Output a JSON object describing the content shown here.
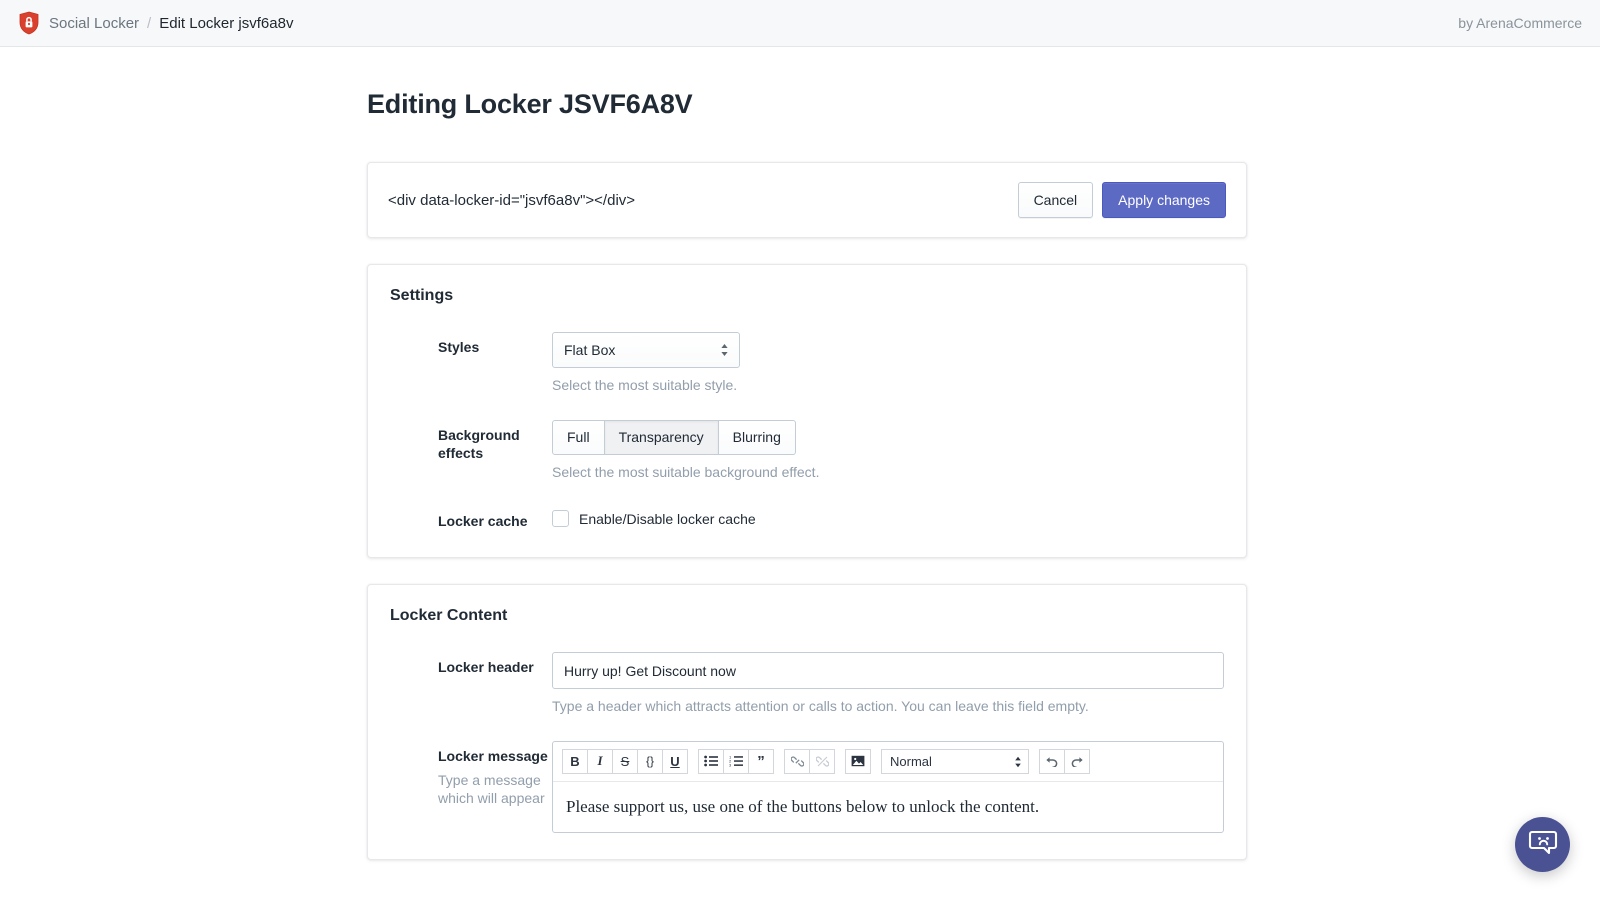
{
  "topbar": {
    "logo_icon": "shield-lock-icon",
    "breadcrumb_root": "Social Locker",
    "breadcrumb_separator": "/",
    "breadcrumb_current": "Edit Locker jsvf6a8v",
    "attribution": "by ArenaCommerce"
  },
  "page": {
    "title": "Editing Locker JSVF6A8V"
  },
  "snippet_card": {
    "code": "<div data-locker-id=\"jsvf6a8v\"></div>",
    "cancel_label": "Cancel",
    "apply_label": "Apply changes"
  },
  "settings": {
    "title": "Settings",
    "styles": {
      "label": "Styles",
      "value": "Flat Box",
      "help": "Select the most suitable style.",
      "options": [
        "Flat Box"
      ]
    },
    "background_effects": {
      "label": "Background effects",
      "options": [
        "Full",
        "Transparency",
        "Blurring"
      ],
      "selected": "Transparency",
      "help": "Select the most suitable background effect."
    },
    "locker_cache": {
      "label": "Locker cache",
      "checkbox_label": "Enable/Disable locker cache",
      "checked": false
    }
  },
  "locker_content": {
    "title": "Locker Content",
    "header_field": {
      "label": "Locker header",
      "value": "Hurry up! Get Discount now",
      "placeholder": "",
      "help": "Type a header which attracts attention or calls to action. You can leave this field empty."
    },
    "message_field": {
      "label": "Locker message",
      "label_help": "Type a message which will appear",
      "toolbar": {
        "bold": "B",
        "italic": "I",
        "strikethrough": "S",
        "code": "{}",
        "underline": "U",
        "bullet_list": "bullet-list-icon",
        "numbered_list": "numbered-list-icon",
        "blockquote": "”",
        "link": "link-icon",
        "unlink": "unlink-icon",
        "image": "image-icon",
        "format_value": "Normal",
        "undo": "undo-icon",
        "redo": "redo-icon"
      },
      "body_text": "Please support us, use one of the buttons below to unlock the content."
    }
  },
  "chat_widget": {
    "icon": "chat-bubble-face-icon",
    "color": "#4a5294"
  },
  "colors": {
    "primary": "#5c6ac4",
    "logo": "#d9412e",
    "text": "#212b36",
    "muted": "#919eab",
    "border": "#c4cdd5",
    "topbar_bg": "#f7f8f9"
  }
}
